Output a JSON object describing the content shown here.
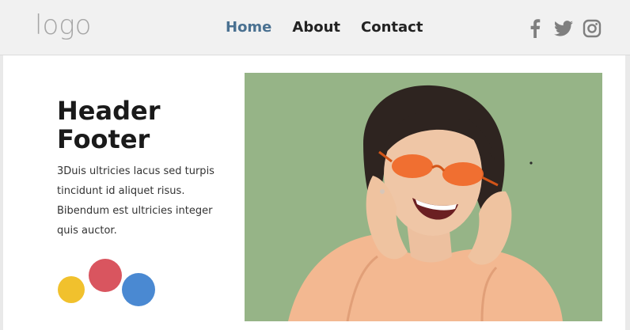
{
  "brand": {
    "logo_text": "logo"
  },
  "nav": {
    "items": [
      {
        "label": "Home",
        "active": true
      },
      {
        "label": "About",
        "active": false
      },
      {
        "label": "Contact",
        "active": false
      }
    ]
  },
  "social": {
    "icons": [
      "facebook-icon",
      "twitter-icon",
      "instagram-icon"
    ]
  },
  "hero": {
    "title_line1": "Header",
    "title_line2": "Footer",
    "body_line1": "3Duis ultricies lacus sed turpis",
    "body_line2": "tincidunt id aliquet risus.",
    "body_line3": "Bibendum est ultricies integer",
    "body_line4": "quis auctor."
  },
  "colors": {
    "nav_active": "#4a7191",
    "dot_yellow": "#f1c12d",
    "dot_red": "#d9555f",
    "dot_blue": "#4a89d2",
    "image_background": "#8fae80"
  }
}
